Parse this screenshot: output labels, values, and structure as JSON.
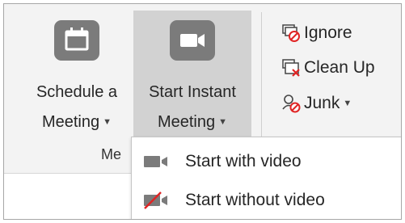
{
  "ribbon": {
    "schedule_button": {
      "line1": "Schedule a",
      "line2": "Meeting",
      "icon": "calendar-icon"
    },
    "instant_button": {
      "line1": "Start Instant",
      "line2": "Meeting",
      "icon": "video-camera-icon"
    },
    "group_label": "Me",
    "small_buttons": [
      {
        "label": "Ignore",
        "icon": "ignore-icon"
      },
      {
        "label": "Clean Up",
        "icon": "clean-up-icon"
      },
      {
        "label": "Junk",
        "icon": "junk-icon"
      }
    ]
  },
  "dropdown": {
    "items": [
      {
        "label": "Start with video",
        "icon": "video-camera-icon"
      },
      {
        "label": "Start without video",
        "icon": "video-off-icon"
      }
    ]
  },
  "colors": {
    "icon_gray": "#7b7b7b",
    "accent_red": "#e02424",
    "hover_bg": "#d2d2d2",
    "ribbon_bg": "#f3f3f3"
  }
}
